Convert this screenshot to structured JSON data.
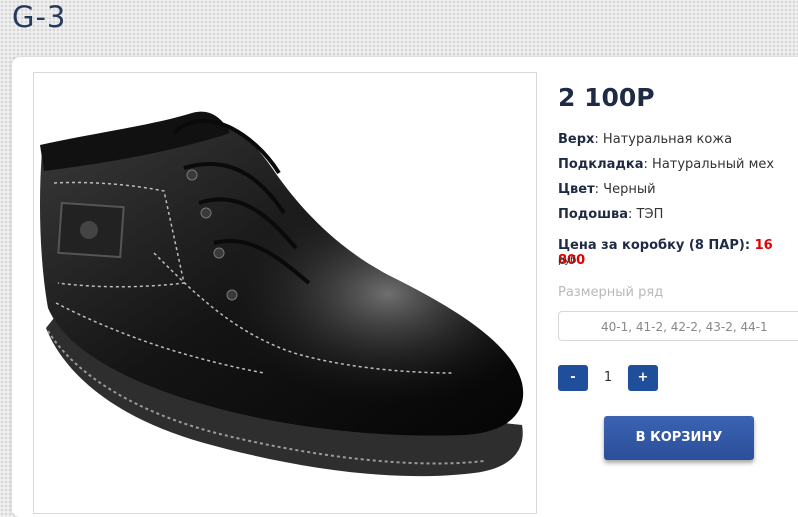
{
  "page": {
    "title": "G-3"
  },
  "product": {
    "image_alt": "Черный кожаный ботинок на шнурках",
    "price": "2 100Р",
    "specs": [
      {
        "label": "Верх",
        "value": ": Натуральная кожа"
      },
      {
        "label": "Подкладка",
        "value": ": Натуральный мех"
      },
      {
        "label": "Цвет",
        "value": ": Черный"
      },
      {
        "label": "Подошва",
        "value": ": ТЭП"
      }
    ],
    "box_price_label": "Цена за коробку (8 ПАР): ",
    "box_price_value": "16 800",
    "currency": "руб",
    "size_label": "Размерный ряд",
    "size_value": "40-1, 41-2, 42-2, 43-2, 44-1",
    "qty_minus": "-",
    "qty_value": "1",
    "qty_plus": "+",
    "cart_button": "В КОРЗИНУ"
  },
  "colors": {
    "primary": "#1f4e9a",
    "price_accent": "#e00000",
    "title": "#273a5d"
  }
}
